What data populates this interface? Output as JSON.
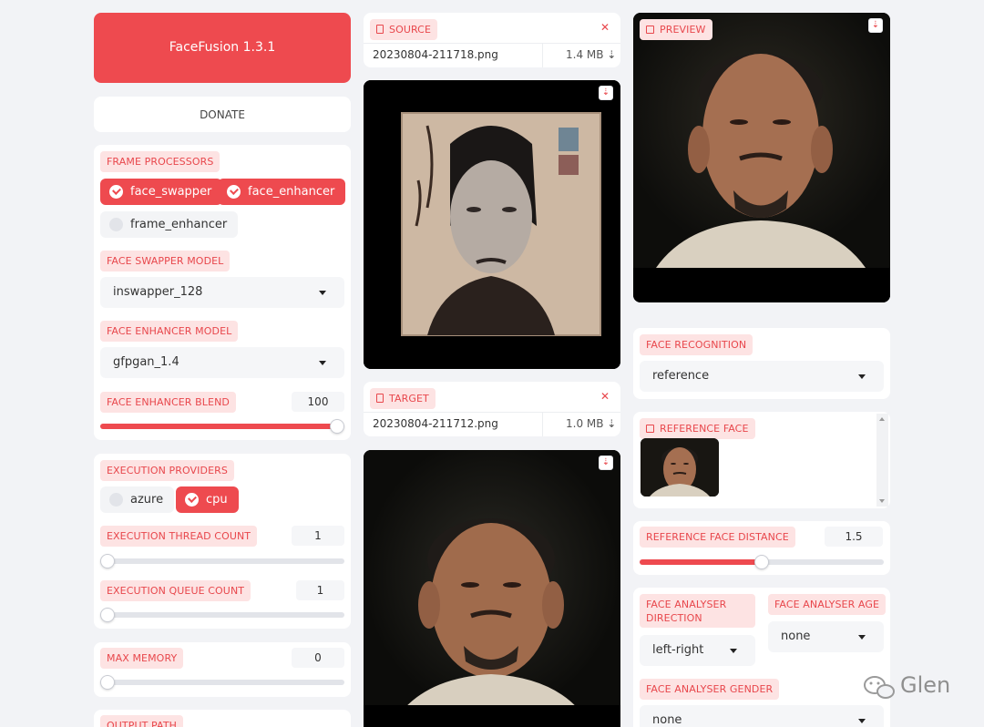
{
  "app": {
    "title": "FaceFusion 1.3.1",
    "donate_label": "DONATE"
  },
  "frame_processors": {
    "label": "FRAME PROCESSORS",
    "items": [
      {
        "name": "face_swapper",
        "checked": true
      },
      {
        "name": "face_enhancer",
        "checked": true
      },
      {
        "name": "frame_enhancer",
        "checked": false
      }
    ]
  },
  "face_swapper_model": {
    "label": "FACE SWAPPER MODEL",
    "value": "inswapper_128"
  },
  "face_enhancer_model": {
    "label": "FACE ENHANCER MODEL",
    "value": "gfpgan_1.4"
  },
  "face_enhancer_blend": {
    "label": "FACE ENHANCER BLEND",
    "value": "100",
    "fraction": 1.0
  },
  "execution_providers": {
    "label": "EXECUTION PROVIDERS",
    "items": [
      {
        "name": "azure",
        "checked": false
      },
      {
        "name": "cpu",
        "checked": true
      }
    ]
  },
  "execution_thread_count": {
    "label": "EXECUTION THREAD COUNT",
    "value": "1",
    "fraction": 0.0
  },
  "execution_queue_count": {
    "label": "EXECUTION QUEUE COUNT",
    "value": "1",
    "fraction": 0.0
  },
  "max_memory": {
    "label": "MAX MEMORY",
    "value": "0",
    "fraction": 0.0
  },
  "output_path": {
    "label": "OUTPUT PATH"
  },
  "source": {
    "label": "SOURCE",
    "filename": "20230804-211718.png",
    "size": "1.4 MB ⇣"
  },
  "target": {
    "label": "TARGET",
    "filename": "20230804-211712.png",
    "size": "1.0 MB ⇣"
  },
  "preview": {
    "label": "PREVIEW"
  },
  "face_recognition": {
    "label": "FACE RECOGNITION",
    "value": "reference"
  },
  "reference_face": {
    "label": "REFERENCE FACE"
  },
  "reference_face_distance": {
    "label": "REFERENCE FACE DISTANCE",
    "value": "1.5",
    "fraction": 0.5
  },
  "face_analyser_direction": {
    "label_line1": "FACE ANALYSER",
    "label_line2": "DIRECTION",
    "value": "left-right"
  },
  "face_analyser_age": {
    "label": "FACE ANALYSER AGE",
    "value": "none"
  },
  "face_analyser_gender": {
    "label": "FACE ANALYSER GENDER",
    "value": "none"
  },
  "watermark": {
    "text": "Glen"
  },
  "colors": {
    "accent": "#ee4a4f",
    "tag_bg": "#fde3e3",
    "page_bg": "#f2f3f6"
  }
}
